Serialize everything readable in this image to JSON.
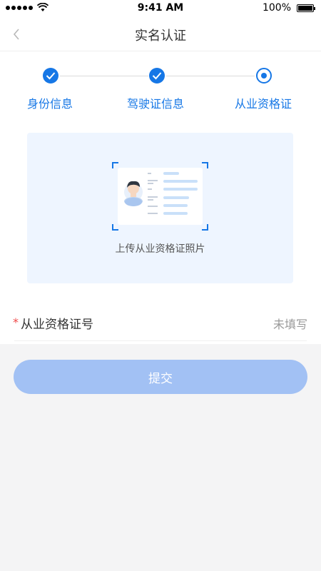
{
  "status_bar": {
    "time": "9:41 AM",
    "battery": "100%",
    "battery_level": 1.0
  },
  "nav": {
    "title": "实名认证",
    "back_icon": "chevron-left-icon"
  },
  "steps": [
    {
      "label": "身份信息",
      "state": "done"
    },
    {
      "label": "驾驶证信息",
      "state": "done"
    },
    {
      "label": "从业资格证",
      "state": "current"
    }
  ],
  "upload": {
    "text": "上传从业资格证照片",
    "icon": "id-card-scan-icon"
  },
  "form": {
    "required_mark": "*",
    "license_number_label": "从业资格证号",
    "license_number_value": "未填写"
  },
  "submit": {
    "label": "提交"
  },
  "colors": {
    "accent": "#1677e6",
    "submit_disabled": "#a2c1f4",
    "upload_bg": "#eef5ff",
    "required": "#f04a4a",
    "page_bg": "#f4f4f5"
  }
}
